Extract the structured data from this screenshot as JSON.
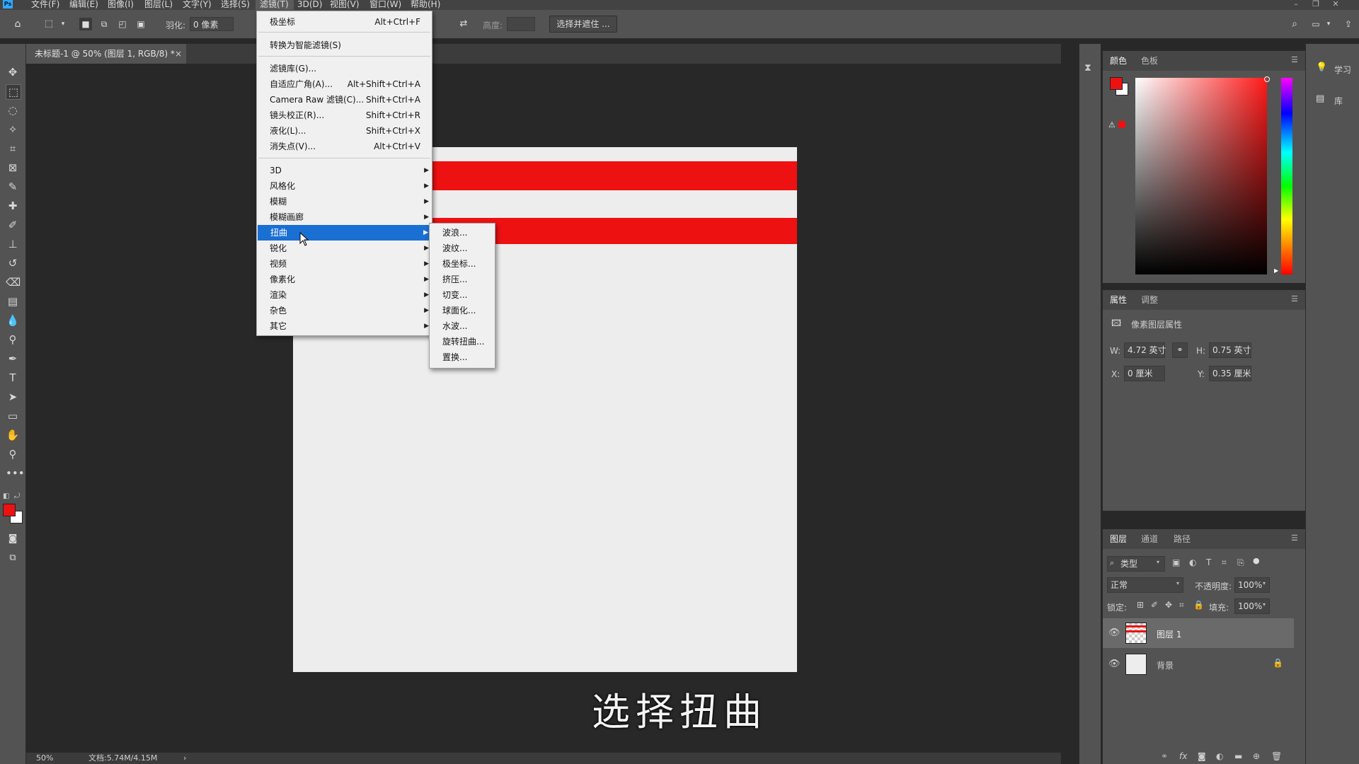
{
  "app": {
    "logo": "Ps"
  },
  "menubar": {
    "items": [
      "文件(F)",
      "编辑(E)",
      "图像(I)",
      "图层(L)",
      "文字(Y)",
      "选择(S)",
      "滤镜(T)",
      "3D(D)",
      "视图(V)",
      "窗口(W)",
      "帮助(H)"
    ],
    "active": "滤镜(T)"
  },
  "window_controls": {
    "minimize": "–",
    "restore": "❐",
    "close": "✕"
  },
  "options": {
    "feather_label": "羽化:",
    "feather_value": "0 像素",
    "height_label": "高度:",
    "select_mask_button": "选择并遮住 ..."
  },
  "document": {
    "tab_title": "未标题-1 @ 50% (图层 1, RGB/8) *",
    "tab_close": "×",
    "stripe_color": "#ee1111",
    "canvas_color": "#ededed"
  },
  "status": {
    "zoom": "50%",
    "doc_size": "文档:5.74M/4.15M",
    "arrow": "›"
  },
  "filter_menu": {
    "items": [
      {
        "label": "极坐标",
        "shortcut": "Alt+Ctrl+F"
      },
      {
        "sep": true
      },
      {
        "label": "转换为智能滤镜(S)",
        "shortcut": ""
      },
      {
        "sep": true
      },
      {
        "label": "滤镜库(G)...",
        "shortcut": ""
      },
      {
        "label": "自适应广角(A)...",
        "shortcut": "Alt+Shift+Ctrl+A"
      },
      {
        "label": "Camera Raw 滤镜(C)...",
        "shortcut": "Shift+Ctrl+A"
      },
      {
        "label": "镜头校正(R)...",
        "shortcut": "Shift+Ctrl+R"
      },
      {
        "label": "液化(L)...",
        "shortcut": "Shift+Ctrl+X"
      },
      {
        "label": "消失点(V)...",
        "shortcut": "Alt+Ctrl+V"
      },
      {
        "sep": true
      },
      {
        "label": "3D",
        "submenu": true
      },
      {
        "label": "风格化",
        "submenu": true
      },
      {
        "label": "模糊",
        "submenu": true
      },
      {
        "label": "模糊画廊",
        "submenu": true
      },
      {
        "label": "扭曲",
        "submenu": true,
        "highlighted": true
      },
      {
        "label": "锐化",
        "submenu": true
      },
      {
        "label": "视频",
        "submenu": true
      },
      {
        "label": "像素化",
        "submenu": true
      },
      {
        "label": "渲染",
        "submenu": true
      },
      {
        "label": "杂色",
        "submenu": true
      },
      {
        "label": "其它",
        "submenu": true
      }
    ]
  },
  "distort_submenu": {
    "items": [
      "波浪...",
      "波纹...",
      "极坐标...",
      "挤压...",
      "切变...",
      "球面化...",
      "水波...",
      "旋转扭曲...",
      "置换..."
    ]
  },
  "color_panel": {
    "tabs": [
      "颜色",
      "色板"
    ],
    "foreground": "#ee1111",
    "background": "#ffffff",
    "hue_color": "#ff1a1a"
  },
  "properties_panel": {
    "tabs": [
      "属性",
      "调整"
    ],
    "section_title": "像素图层属性",
    "w_label": "W:",
    "w_value": "4.72 英寸",
    "h_label": "H:",
    "h_value": "0.75 英寸",
    "x_label": "X:",
    "x_value": "0 厘米",
    "y_label": "Y:",
    "y_value": "0.35 厘米"
  },
  "layers_panel": {
    "tabs": [
      "图层",
      "通道",
      "路径"
    ],
    "filter_kind": "类型",
    "blend_mode": "正常",
    "opacity_label": "不透明度:",
    "opacity_value": "100%",
    "lock_label": "锁定:",
    "fill_label": "填充:",
    "fill_value": "100%",
    "layers": [
      {
        "name": "图层 1",
        "selected": true
      },
      {
        "name": "背景",
        "locked": true
      }
    ]
  },
  "learn_panel": {
    "learn": "学习",
    "library": "库"
  },
  "subtitle": "选择扭曲"
}
